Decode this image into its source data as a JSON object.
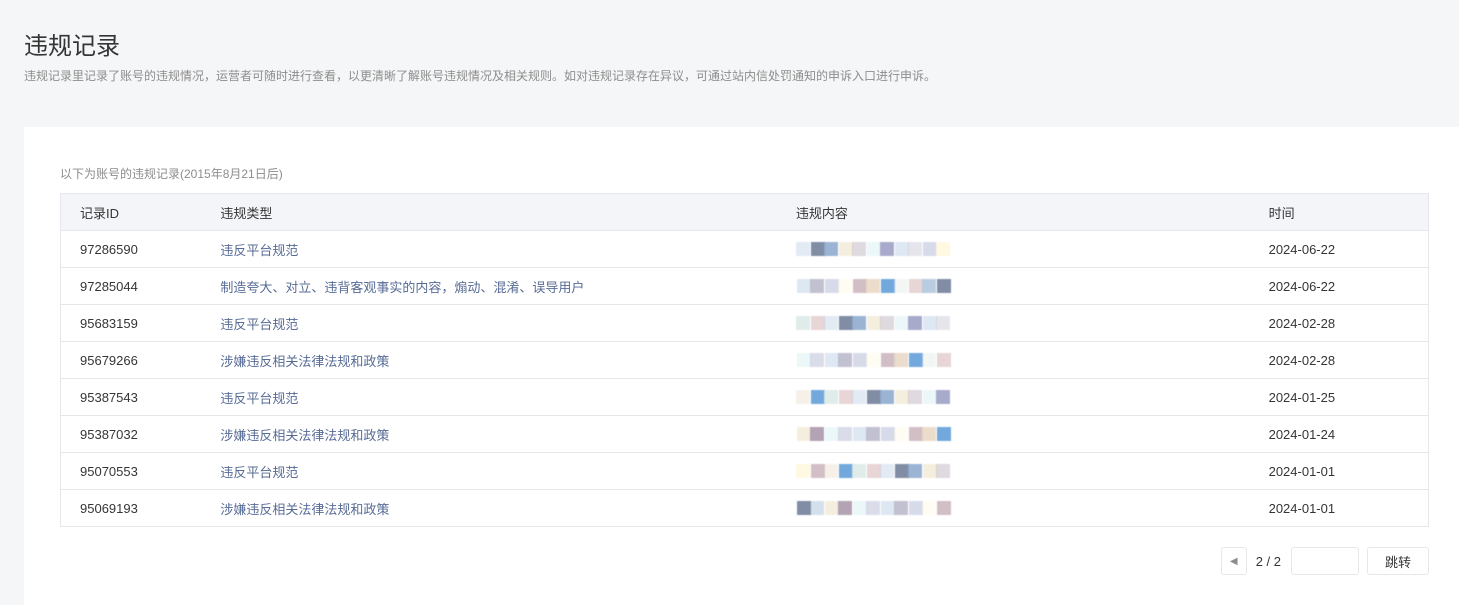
{
  "header": {
    "title": "违规记录",
    "description": "违规记录里记录了账号的违规情况，运营者可随时进行查看，以更清晰了解账号违规情况及相关规则。如对违规记录存在异议，可通过站内信处罚通知的申诉入口进行申诉。"
  },
  "records": {
    "caption": "以下为账号的违规记录(2015年8月21日后)",
    "columns": [
      "记录ID",
      "违规类型",
      "违规内容",
      "时间"
    ],
    "rows": [
      {
        "id": "97286590",
        "type": "违反平台规范",
        "time": "2024-06-22"
      },
      {
        "id": "97285044",
        "type": "制造夸大、对立、违背客观事实的内容，煽动、混淆、误导用户",
        "time": "2024-06-22"
      },
      {
        "id": "95683159",
        "type": "违反平台规范",
        "time": "2024-02-28"
      },
      {
        "id": "95679266",
        "type": "涉嫌违反相关法律法规和政策",
        "time": "2024-02-28"
      },
      {
        "id": "95387543",
        "type": "违反平台规范",
        "time": "2024-01-25"
      },
      {
        "id": "95387032",
        "type": "涉嫌违反相关法律法规和政策",
        "time": "2024-01-24"
      },
      {
        "id": "95070553",
        "type": "违反平台规范",
        "time": "2024-01-01"
      },
      {
        "id": "95069193",
        "type": "涉嫌违反相关法律法规和政策",
        "time": "2024-01-01"
      }
    ]
  },
  "pagination": {
    "page_indicator": "2 / 2",
    "jump_input_value": "",
    "jump_label": "跳转",
    "prev_icon": "caret-left-icon"
  },
  "colors": {
    "link": "#576b95",
    "border": "#e7e7eb",
    "header_bg": "#f4f5f9",
    "page_bg": "#f5f6f7"
  }
}
